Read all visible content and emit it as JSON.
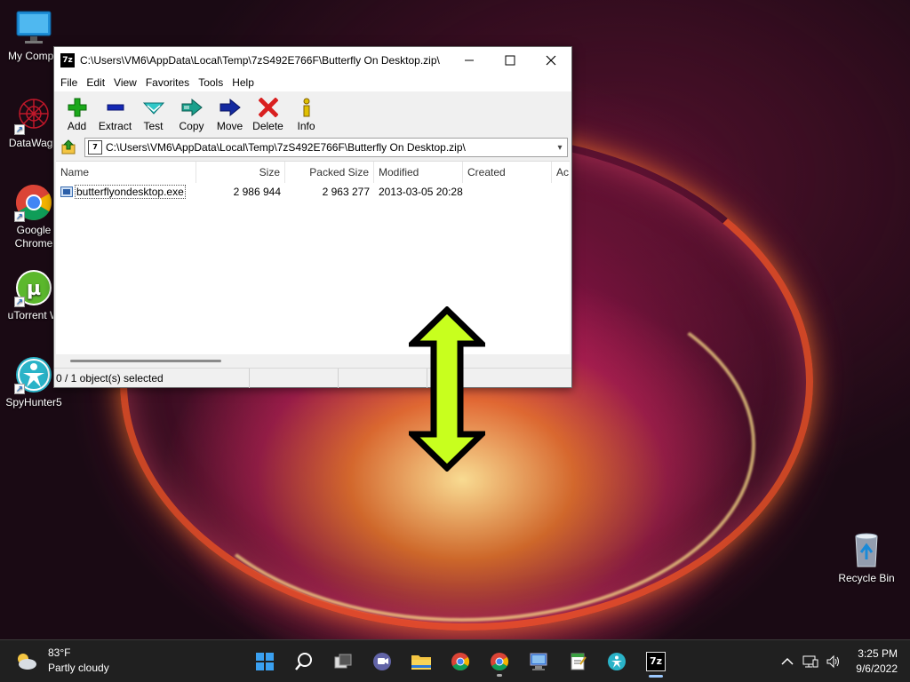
{
  "desktop": {
    "icons": [
      {
        "label": "My Compu"
      },
      {
        "label": "DataWago"
      },
      {
        "label": "Google\nChrome"
      },
      {
        "label": "uTorrent W"
      },
      {
        "label": "SpyHunter5"
      },
      {
        "label": "Recycle Bin"
      }
    ]
  },
  "window": {
    "title": "C:\\Users\\VM6\\AppData\\Local\\Temp\\7zS492E766F\\Butterfly On Desktop.zip\\",
    "logo_text": "7z",
    "menu": [
      "File",
      "Edit",
      "View",
      "Favorites",
      "Tools",
      "Help"
    ],
    "toolbar": {
      "add": "Add",
      "extract": "Extract",
      "test": "Test",
      "copy": "Copy",
      "move": "Move",
      "delete": "Delete",
      "info": "Info"
    },
    "address": "C:\\Users\\VM6\\AppData\\Local\\Temp\\7zS492E766F\\Butterfly On Desktop.zip\\",
    "columns": {
      "name": "Name",
      "size": "Size",
      "packed": "Packed Size",
      "modified": "Modified",
      "created": "Created",
      "accessed": "Ac"
    },
    "files": [
      {
        "name": "butterflyondesktop.exe",
        "size": "2 986 944",
        "packed": "2 963 277",
        "modified": "2013-03-05 20:28"
      }
    ],
    "status": "0 / 1 object(s) selected"
  },
  "taskbar": {
    "weather_temp": "83°F",
    "weather_desc": "Partly cloudy",
    "time": "3:25 PM",
    "date": "9/6/2022",
    "app_logo_text": "7z"
  },
  "colors": {
    "taskbar_bg": "#202020",
    "arrow_fill": "#c8ff1e",
    "delete_red": "#d92020",
    "add_green": "#1aa81a"
  }
}
